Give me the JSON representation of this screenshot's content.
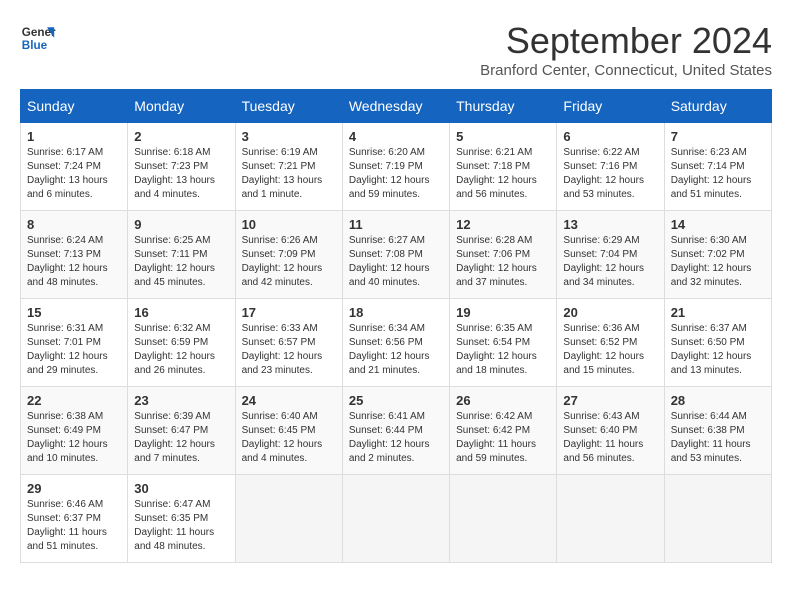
{
  "header": {
    "logo_line1": "General",
    "logo_line2": "Blue",
    "title": "September 2024",
    "subtitle": "Branford Center, Connecticut, United States"
  },
  "days_of_week": [
    "Sunday",
    "Monday",
    "Tuesday",
    "Wednesday",
    "Thursday",
    "Friday",
    "Saturday"
  ],
  "weeks": [
    [
      {
        "day": "1",
        "sunrise": "6:17 AM",
        "sunset": "7:24 PM",
        "daylight": "13 hours and 6 minutes."
      },
      {
        "day": "2",
        "sunrise": "6:18 AM",
        "sunset": "7:23 PM",
        "daylight": "13 hours and 4 minutes."
      },
      {
        "day": "3",
        "sunrise": "6:19 AM",
        "sunset": "7:21 PM",
        "daylight": "13 hours and 1 minute."
      },
      {
        "day": "4",
        "sunrise": "6:20 AM",
        "sunset": "7:19 PM",
        "daylight": "12 hours and 59 minutes."
      },
      {
        "day": "5",
        "sunrise": "6:21 AM",
        "sunset": "7:18 PM",
        "daylight": "12 hours and 56 minutes."
      },
      {
        "day": "6",
        "sunrise": "6:22 AM",
        "sunset": "7:16 PM",
        "daylight": "12 hours and 53 minutes."
      },
      {
        "day": "7",
        "sunrise": "6:23 AM",
        "sunset": "7:14 PM",
        "daylight": "12 hours and 51 minutes."
      }
    ],
    [
      {
        "day": "8",
        "sunrise": "6:24 AM",
        "sunset": "7:13 PM",
        "daylight": "12 hours and 48 minutes."
      },
      {
        "day": "9",
        "sunrise": "6:25 AM",
        "sunset": "7:11 PM",
        "daylight": "12 hours and 45 minutes."
      },
      {
        "day": "10",
        "sunrise": "6:26 AM",
        "sunset": "7:09 PM",
        "daylight": "12 hours and 42 minutes."
      },
      {
        "day": "11",
        "sunrise": "6:27 AM",
        "sunset": "7:08 PM",
        "daylight": "12 hours and 40 minutes."
      },
      {
        "day": "12",
        "sunrise": "6:28 AM",
        "sunset": "7:06 PM",
        "daylight": "12 hours and 37 minutes."
      },
      {
        "day": "13",
        "sunrise": "6:29 AM",
        "sunset": "7:04 PM",
        "daylight": "12 hours and 34 minutes."
      },
      {
        "day": "14",
        "sunrise": "6:30 AM",
        "sunset": "7:02 PM",
        "daylight": "12 hours and 32 minutes."
      }
    ],
    [
      {
        "day": "15",
        "sunrise": "6:31 AM",
        "sunset": "7:01 PM",
        "daylight": "12 hours and 29 minutes."
      },
      {
        "day": "16",
        "sunrise": "6:32 AM",
        "sunset": "6:59 PM",
        "daylight": "12 hours and 26 minutes."
      },
      {
        "day": "17",
        "sunrise": "6:33 AM",
        "sunset": "6:57 PM",
        "daylight": "12 hours and 23 minutes."
      },
      {
        "day": "18",
        "sunrise": "6:34 AM",
        "sunset": "6:56 PM",
        "daylight": "12 hours and 21 minutes."
      },
      {
        "day": "19",
        "sunrise": "6:35 AM",
        "sunset": "6:54 PM",
        "daylight": "12 hours and 18 minutes."
      },
      {
        "day": "20",
        "sunrise": "6:36 AM",
        "sunset": "6:52 PM",
        "daylight": "12 hours and 15 minutes."
      },
      {
        "day": "21",
        "sunrise": "6:37 AM",
        "sunset": "6:50 PM",
        "daylight": "12 hours and 13 minutes."
      }
    ],
    [
      {
        "day": "22",
        "sunrise": "6:38 AM",
        "sunset": "6:49 PM",
        "daylight": "12 hours and 10 minutes."
      },
      {
        "day": "23",
        "sunrise": "6:39 AM",
        "sunset": "6:47 PM",
        "daylight": "12 hours and 7 minutes."
      },
      {
        "day": "24",
        "sunrise": "6:40 AM",
        "sunset": "6:45 PM",
        "daylight": "12 hours and 4 minutes."
      },
      {
        "day": "25",
        "sunrise": "6:41 AM",
        "sunset": "6:44 PM",
        "daylight": "12 hours and 2 minutes."
      },
      {
        "day": "26",
        "sunrise": "6:42 AM",
        "sunset": "6:42 PM",
        "daylight": "11 hours and 59 minutes."
      },
      {
        "day": "27",
        "sunrise": "6:43 AM",
        "sunset": "6:40 PM",
        "daylight": "11 hours and 56 minutes."
      },
      {
        "day": "28",
        "sunrise": "6:44 AM",
        "sunset": "6:38 PM",
        "daylight": "11 hours and 53 minutes."
      }
    ],
    [
      {
        "day": "29",
        "sunrise": "6:46 AM",
        "sunset": "6:37 PM",
        "daylight": "11 hours and 51 minutes."
      },
      {
        "day": "30",
        "sunrise": "6:47 AM",
        "sunset": "6:35 PM",
        "daylight": "11 hours and 48 minutes."
      },
      null,
      null,
      null,
      null,
      null
    ]
  ],
  "labels": {
    "sunrise": "Sunrise:",
    "sunset": "Sunset:",
    "daylight": "Daylight:"
  }
}
